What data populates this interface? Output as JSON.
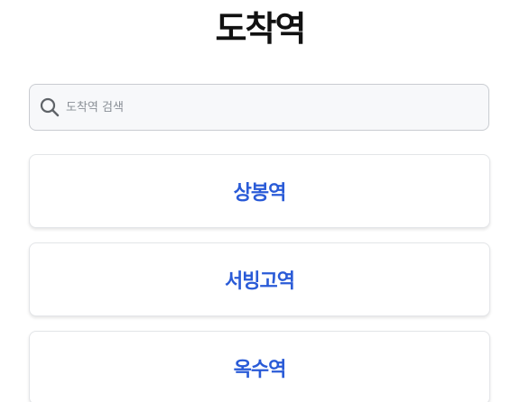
{
  "header": {
    "title": "도착역"
  },
  "search": {
    "placeholder": "도착역 검색",
    "value": ""
  },
  "stations": [
    {
      "label": "상봉역"
    },
    {
      "label": "서빙고역"
    },
    {
      "label": "옥수역"
    }
  ],
  "colors": {
    "accent": "#2a5bd7",
    "title": "#111111",
    "search_bg": "#f7f8fa",
    "search_border": "#c9ccd1"
  },
  "icons": {
    "search": "search-icon"
  }
}
